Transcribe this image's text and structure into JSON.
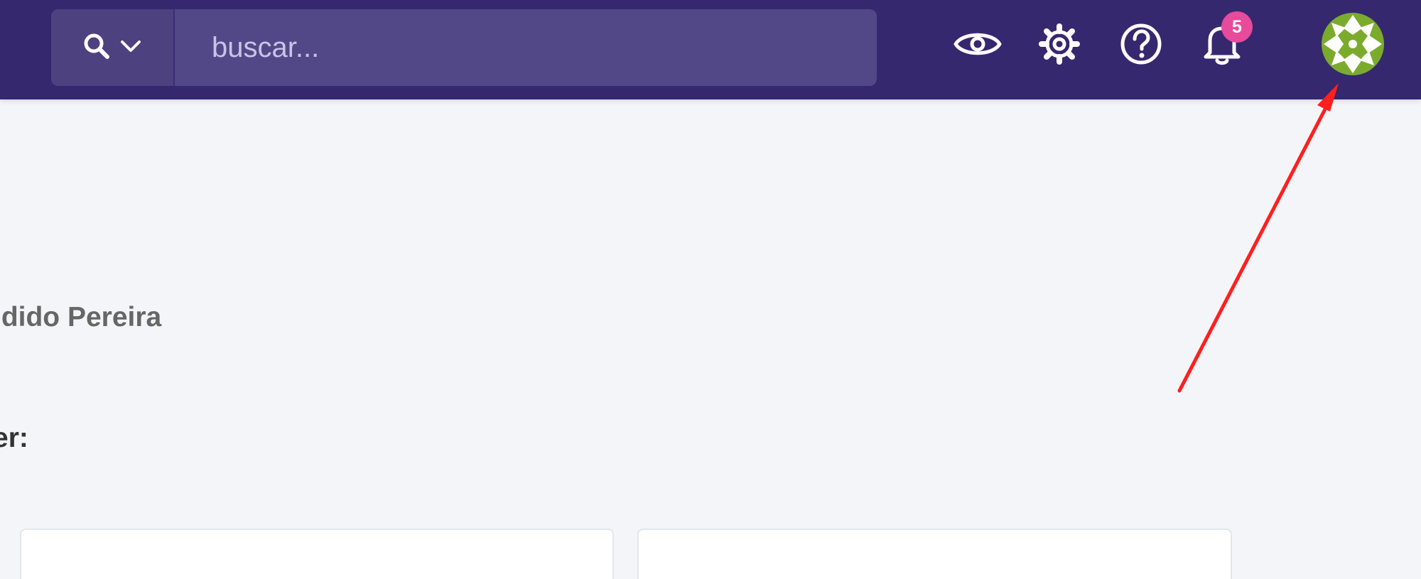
{
  "header": {
    "search": {
      "placeholder": "buscar...",
      "toggle_icon": "search-icon",
      "toggle_chevron": "chevron-down-icon"
    },
    "actions": [
      {
        "name": "eye",
        "icon": "eye-icon"
      },
      {
        "name": "settings",
        "icon": "gear-icon"
      },
      {
        "name": "help",
        "icon": "question-icon"
      },
      {
        "name": "notifications",
        "icon": "bell-icon",
        "badge": "5"
      }
    ],
    "avatar": {
      "icon": "user-avatar-pattern"
    }
  },
  "content": {
    "user_name_partial": "ndido Pereira",
    "section_label_partial": "er:",
    "cards": [
      {
        "label": ""
      },
      {
        "label": ""
      }
    ]
  },
  "annotation": {
    "arrow_color": "#ff1f1f"
  },
  "colors": {
    "header_bg": "#35286f",
    "search_bg": "#534887",
    "page_bg": "#f4f5f8",
    "badge_bg": "#e84a9c",
    "avatar_green": "#7bab2d"
  }
}
